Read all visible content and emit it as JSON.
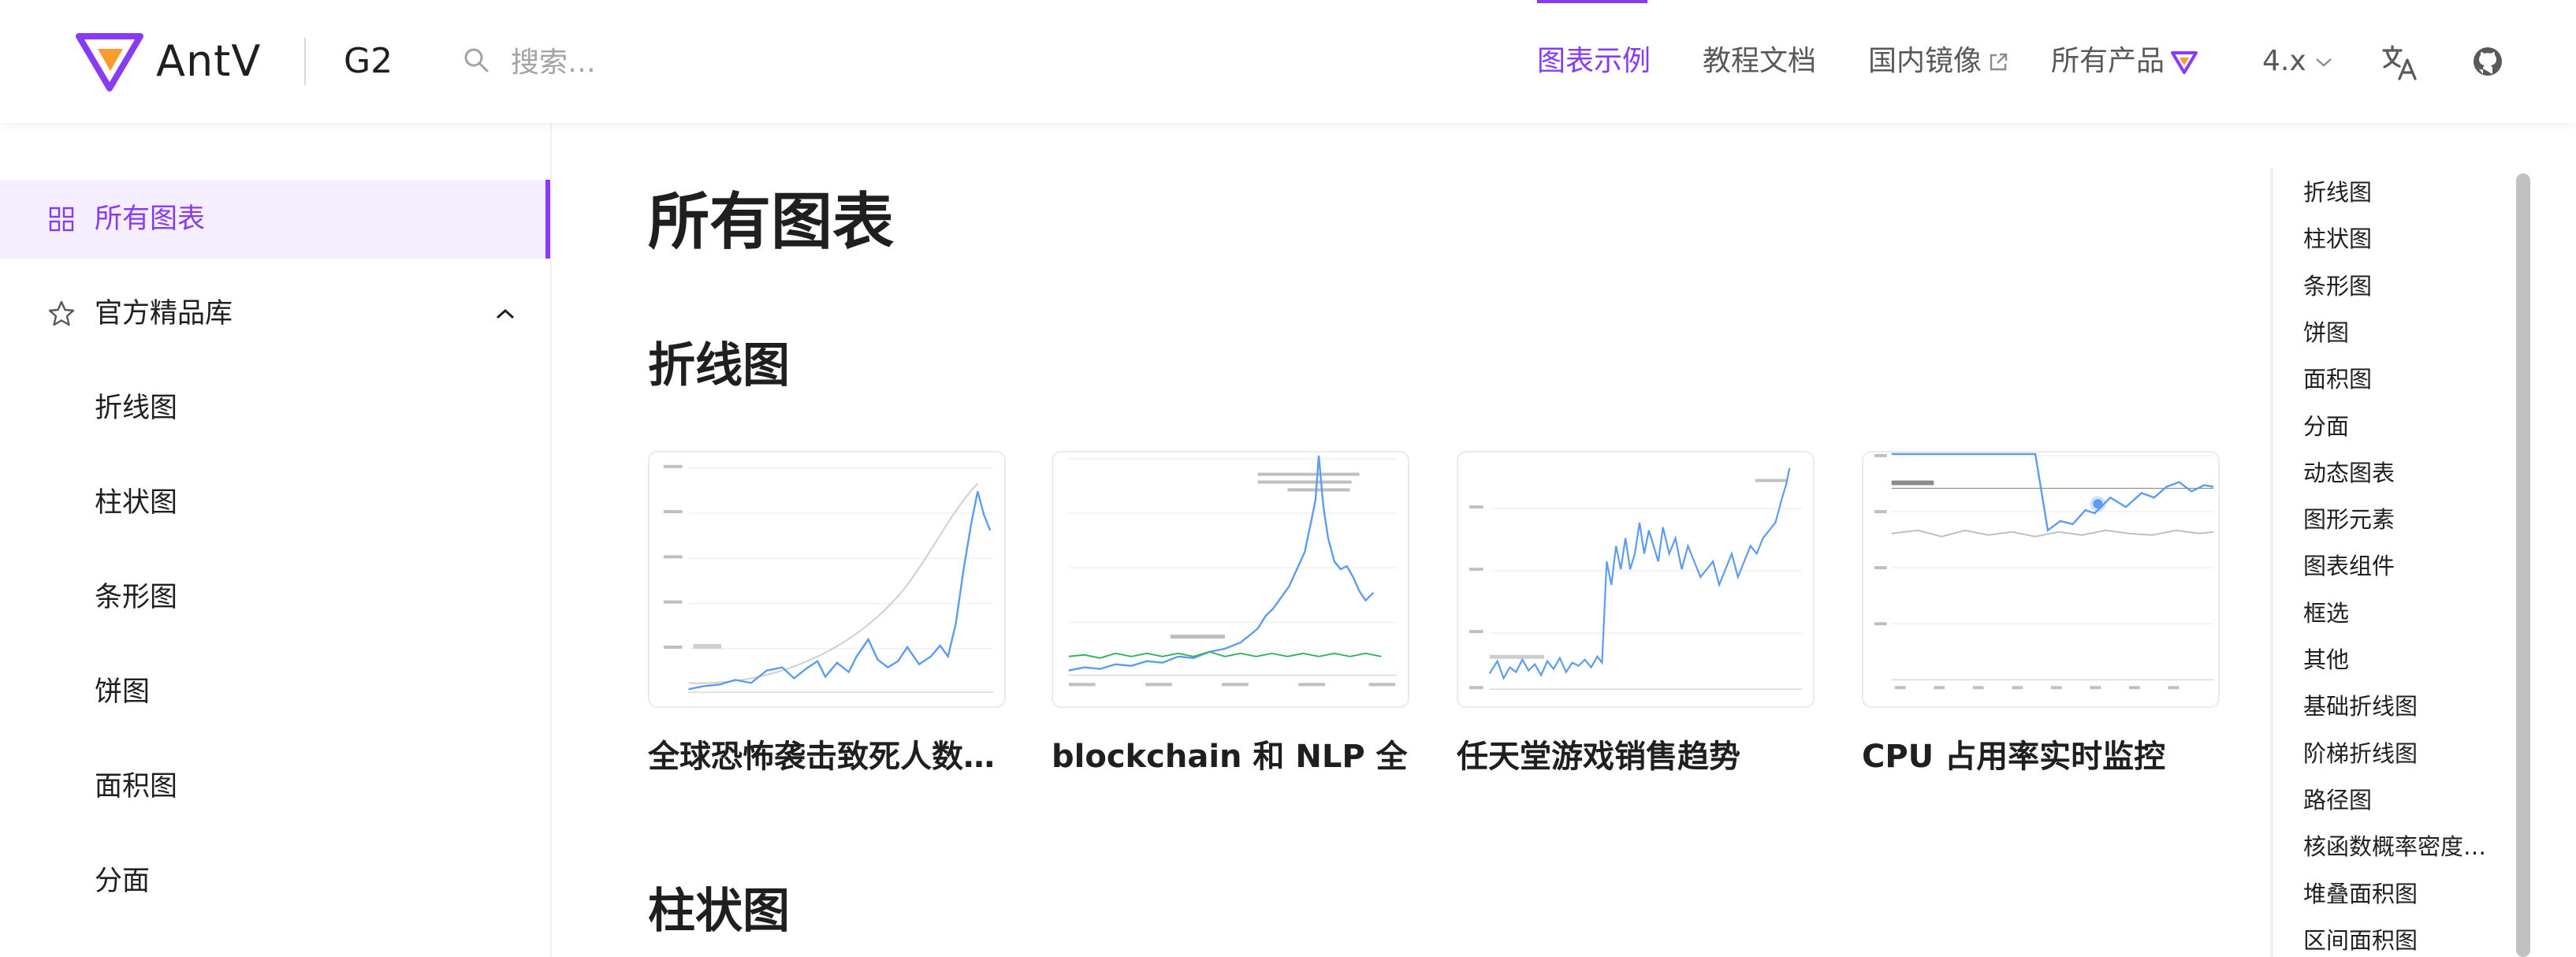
{
  "header": {
    "brand": "AntV",
    "product": "G2",
    "search_placeholder": "搜索…",
    "nav": [
      "图表示例",
      "教程文档",
      "国内镜像",
      "所有产品"
    ],
    "version": "4.x",
    "icons": [
      "antv-logo-icon",
      "search-icon",
      "external-link-icon",
      "antv-triangle-icon",
      "chevron-down-icon",
      "translate-icon",
      "github-icon"
    ]
  },
  "sidebar": {
    "items": [
      {
        "label": "所有图表",
        "icon": "grid-icon",
        "active": true
      },
      {
        "label": "官方精品库",
        "icon": "star-icon",
        "expanded": true
      },
      {
        "label": "折线图"
      },
      {
        "label": "柱状图"
      },
      {
        "label": "条形图"
      },
      {
        "label": "饼图"
      },
      {
        "label": "面积图"
      },
      {
        "label": "分面"
      }
    ]
  },
  "main": {
    "title": "所有图表",
    "sections": [
      "折线图",
      "柱状图"
    ],
    "cards": [
      {
        "title": "全球恐怖袭击致死人数…"
      },
      {
        "title": "blockchain 和 NLP 全…"
      },
      {
        "title": "任天堂游戏销售趋势"
      },
      {
        "title": "CPU 占用率实时监控"
      }
    ]
  },
  "toc": {
    "items": [
      "折线图",
      "柱状图",
      "条形图",
      "饼图",
      "面积图",
      "分面",
      "动态图表",
      "图形元素",
      "图表组件",
      "框选",
      "其他",
      "基础折线图",
      "阶梯折线图",
      "路径图",
      "核函数概率密度…",
      "堆叠面积图",
      "区间面积图"
    ]
  },
  "colors": {
    "accent": "#873bf4",
    "active_bg": "#f5eefe",
    "line": "#5b9bf0"
  }
}
